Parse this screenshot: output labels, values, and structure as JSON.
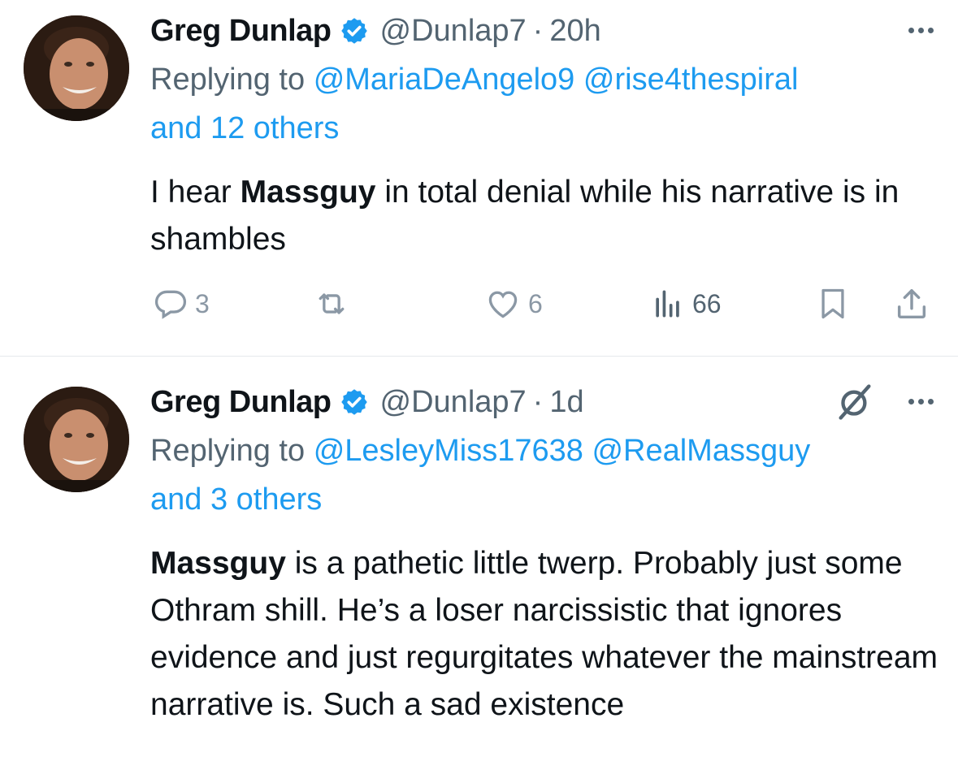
{
  "tweets": [
    {
      "author_name": "Greg Dunlap",
      "handle": "@Dunlap7",
      "separator": "·",
      "time": "20h",
      "replying_prefix": "Replying to",
      "mentions": [
        "@MariaDeAngelo9",
        "@rise4thespiral"
      ],
      "and_others": "and 12 others",
      "body_before": "I hear ",
      "body_bold": "Massguy",
      "body_after": " in total denial while his narrative is in shambles",
      "replies": "3",
      "likes": "6",
      "views": "66",
      "icons": [
        "verified-badge-icon",
        "more-icon",
        "reply-icon",
        "retweet-icon",
        "like-icon",
        "views-icon",
        "bookmark-icon",
        "share-icon"
      ]
    },
    {
      "author_name": "Greg Dunlap",
      "handle": "@Dunlap7",
      "separator": "·",
      "time": "1d",
      "replying_prefix": "Replying to",
      "mentions": [
        "@LesleyMiss17638",
        "@RealMassguy"
      ],
      "and_others": "and 3 others",
      "body_before": "",
      "body_bold": "Massguy",
      "body_after": " is a pathetic little twerp. Probably just some Othram shill. He’s a loser narcissistic that ignores evidence and just regurgitates whatever the mainstream narrative is. Such a sad existence",
      "icons": [
        "verified-badge-icon",
        "grok-icon",
        "more-icon"
      ]
    }
  ],
  "colors": {
    "link": "#1d9bf0",
    "verified": "#1d9bf0",
    "secondary_text": "#536471",
    "action_icon": "#8b98a5",
    "divider": "#e6e9ec"
  }
}
